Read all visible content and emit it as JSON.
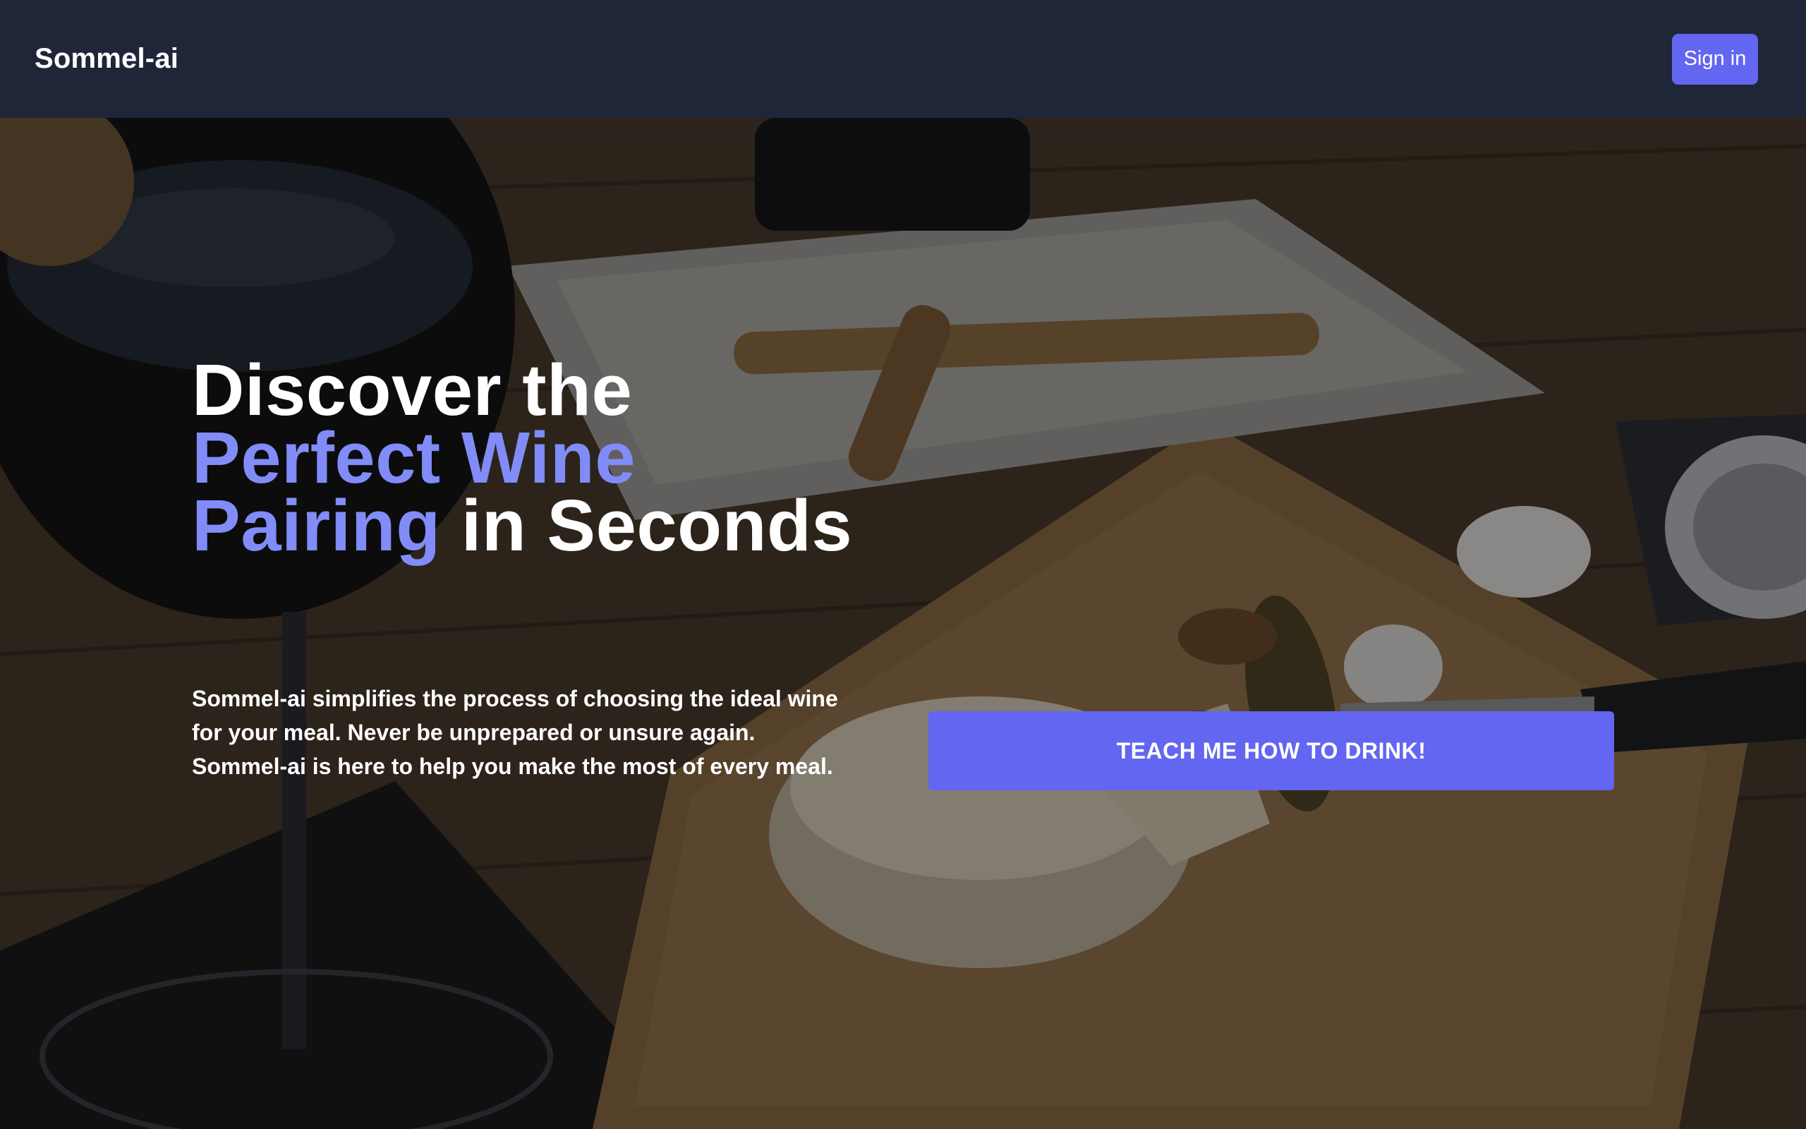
{
  "header": {
    "brand": "Sommel-ai",
    "signin_label": "Sign in"
  },
  "hero": {
    "headline": {
      "line1": "Discover the",
      "line2_accent": "Perfect Wine",
      "line3_accent": "Pairing",
      "line3_rest": " in Seconds"
    },
    "description": "Sommel-ai simplifies the process of choosing the ideal wine for your meal. Never be unprepared or unsure again. Sommel-ai is here to help you make the most of every meal.",
    "cta_label": "TEACH ME HOW TO DRINK!"
  },
  "colors": {
    "header_bg": "#1f2638",
    "accent": "#6366f1",
    "accent_text": "#818cf8",
    "text": "#ffffff"
  },
  "background_image": "wine-and-cheese-photo"
}
